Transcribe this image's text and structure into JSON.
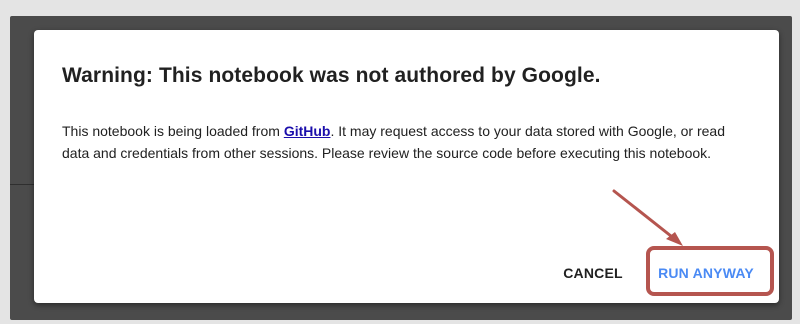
{
  "dialog": {
    "title": "Warning: This notebook was not authored by Google.",
    "body_before_link": "This notebook is being loaded from ",
    "link_text": "GitHub",
    "body_after_link": ". It may request access to your data stored with Google, or read data and credentials from other sessions. Please review the source code before executing this notebook.",
    "cancel_label": "CANCEL",
    "run_anyway_label": "RUN ANYWAY"
  },
  "colors": {
    "accent_button": "#4a8af4",
    "link": "#1a0dab",
    "highlight_annotation": "#b5554f"
  },
  "icons": [
    "arrow-annotation-icon"
  ]
}
